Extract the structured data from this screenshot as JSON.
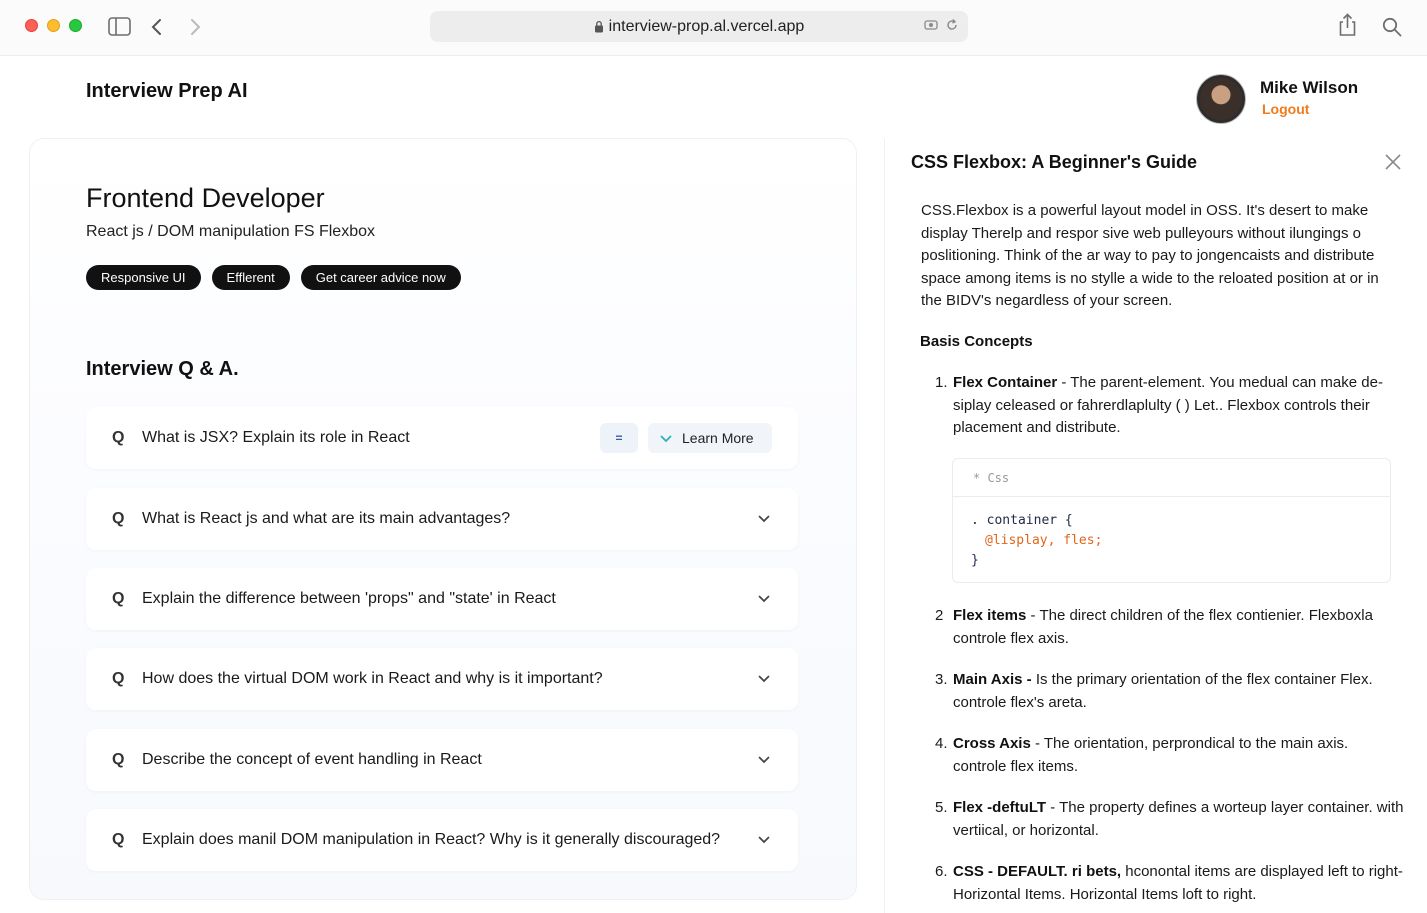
{
  "browser": {
    "url": "interview-prop.al.vercel.app"
  },
  "header": {
    "app_title": "Interview Prep AI",
    "user_name": "Mike Wilson",
    "logout_label": "Logout"
  },
  "role": {
    "title": "Frontend Developer",
    "subtitle": "React js / DOM manipulation FS Flexbox",
    "pills": [
      "Responsive UI",
      "Efflerent",
      "Get career advice now"
    ]
  },
  "qa": {
    "heading": "Interview Q & A.",
    "q_marker": "Q",
    "pin_label": "=",
    "learn_more_label": "Learn More",
    "questions": [
      "What is JSX? Explain its role in React",
      "What is React js and what are its main advantages?",
      "Explain the difference between 'props\" and \"state' in React",
      "How does the virtual DOM work in React and why is it important?",
      "Describe the concept of event handling in React",
      "Explain does manil DOM manipulation in React? Why is it generally discouraged?"
    ]
  },
  "guide": {
    "title": "CSS Flexbox: A Beginner's Guide",
    "intro": "CSS.Flexbox is a powerful layout model in OSS. It's desert to make display Therelp and respor sive web pulleyours without ilungings o poslitioning. Think of the ar way to pay to jongencaists and distribute space among items is no stylle a wide to the reloated position at or in the BIDV's negardless of your screen.",
    "section_title": "Basis Concepts",
    "concepts": [
      {
        "num": "1.",
        "term": "Flex Container",
        "sep": " - ",
        "text": "The parent-element. You medual can make de-siplay celeased or fahrerdlaplulty ( ) Let.. Flexbox controls their placement and distribute."
      },
      {
        "num": "2",
        "term": "Flex items",
        "sep": "  -  ",
        "text": "The direct children of the flex contienier.  Flexboxla controle flex axis."
      },
      {
        "num": "3.",
        "term": "Main Axis -",
        "sep": "  ",
        "text": "Is the primary orientation of the flex container  Flex. controle flex's areta."
      },
      {
        "num": "4.",
        "term": "Cross Axis",
        "sep": "  -  ",
        "text": "The orientation, perprondical to the main axis. controle flex items."
      },
      {
        "num": "5.",
        "term": "Flex -deftuLT",
        "sep": " - ",
        "text": "The property defines a worteup layer container. with vertiical, or horizontal."
      },
      {
        "num": "6.",
        "term": "CSS - DEFAULT. ri bets,",
        "sep": " ",
        "text": "hconontal items are displayed left to right-Horizontal Items.  Horizontal Items loft to right."
      }
    ],
    "code": {
      "lang": "* Css",
      "line1": ". container {",
      "line2_prop": "@lisplay, fles;",
      "line3": "}"
    }
  }
}
